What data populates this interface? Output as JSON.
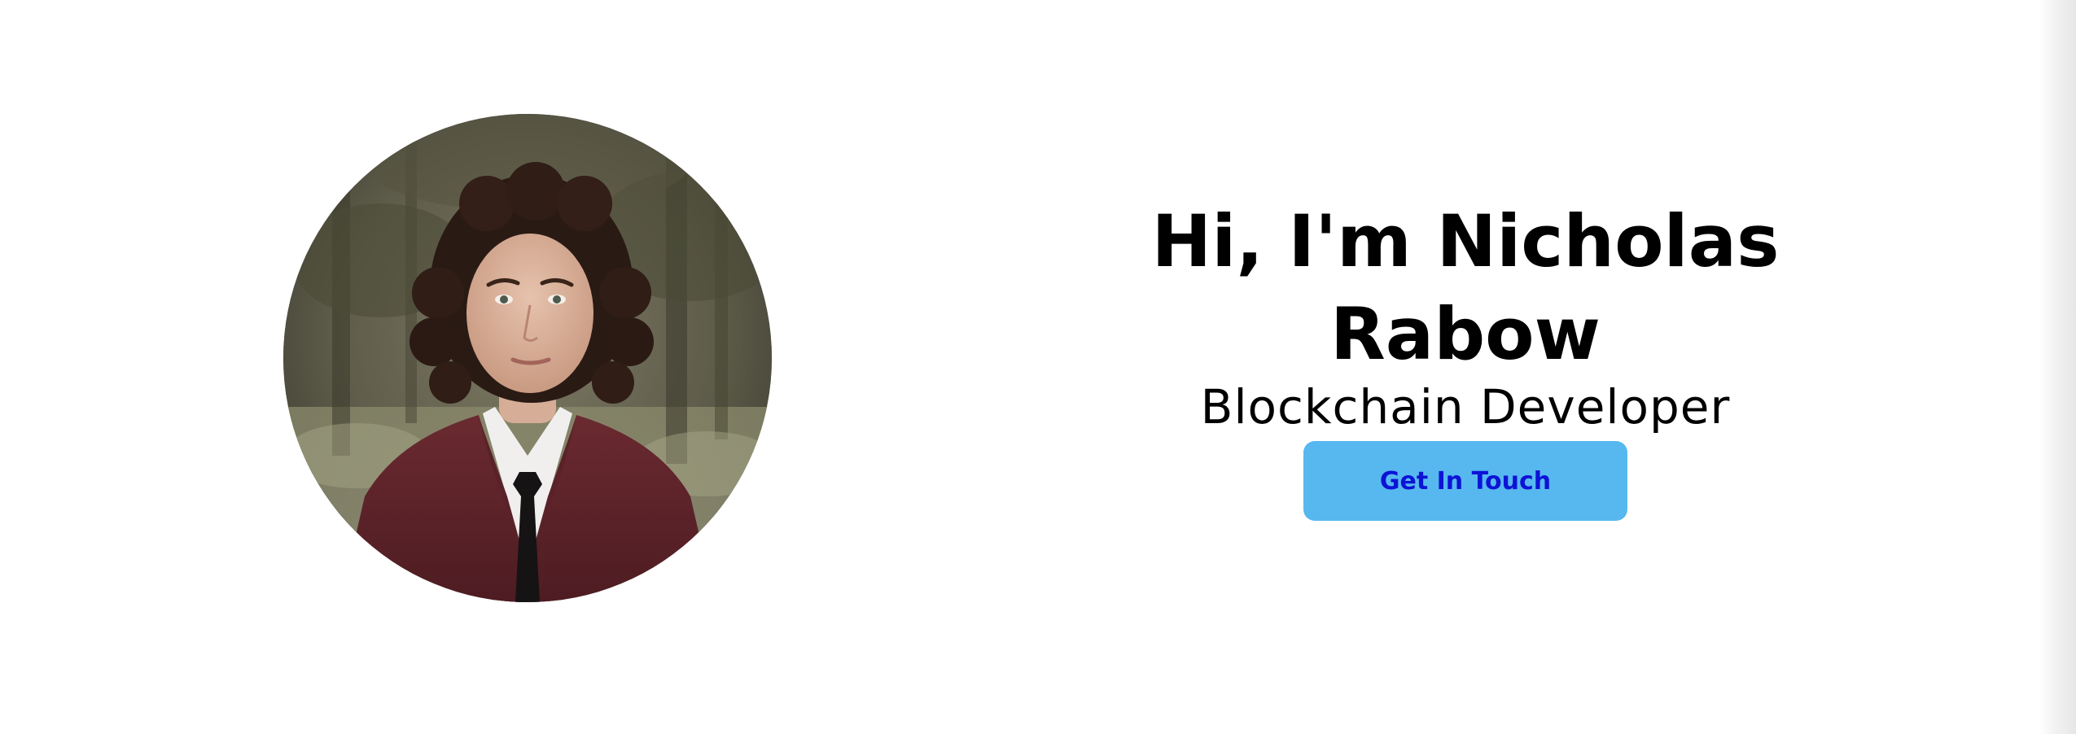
{
  "hero": {
    "title": "Hi, I'm Nicholas Rabow",
    "subtitle": "Blockchain Developer",
    "cta_label": "Get In Touch"
  },
  "colors": {
    "background": "#ffffff",
    "button_background": "#56b8ef",
    "button_text": "#0d12d6",
    "text": "#000000"
  }
}
